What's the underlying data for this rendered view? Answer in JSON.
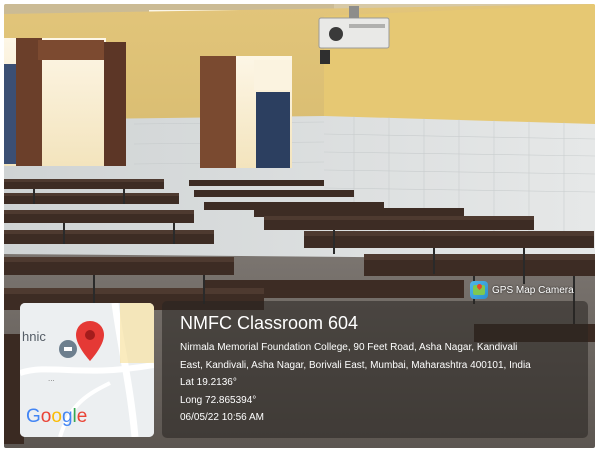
{
  "photo": {
    "description_alt": "Empty classroom with rows of dark wooden benches and desks, yellow and white tiled walls, windows with brown curtains, ceiling projector"
  },
  "badge": {
    "label": "GPS Map Camera",
    "icon": "gps-map-camera-icon"
  },
  "map": {
    "place_label": "hnic",
    "logo": [
      "G",
      "o",
      "o",
      "g",
      "l",
      "e"
    ],
    "pin_color": "#e53935"
  },
  "stamp": {
    "title": "NMFC Classroom 604",
    "address_line1": "Nirmala Memorial Foundation College, 90 Feet Road, Asha Nagar, Kandivali",
    "address_line2": "East, Kandivali, Asha Nagar, Borivali East, Mumbai, Maharashtra 400101, India",
    "lat": "Lat 19.2136°",
    "long": "Long 72.865394°",
    "datetime": "06/05/22 10:56 AM"
  }
}
